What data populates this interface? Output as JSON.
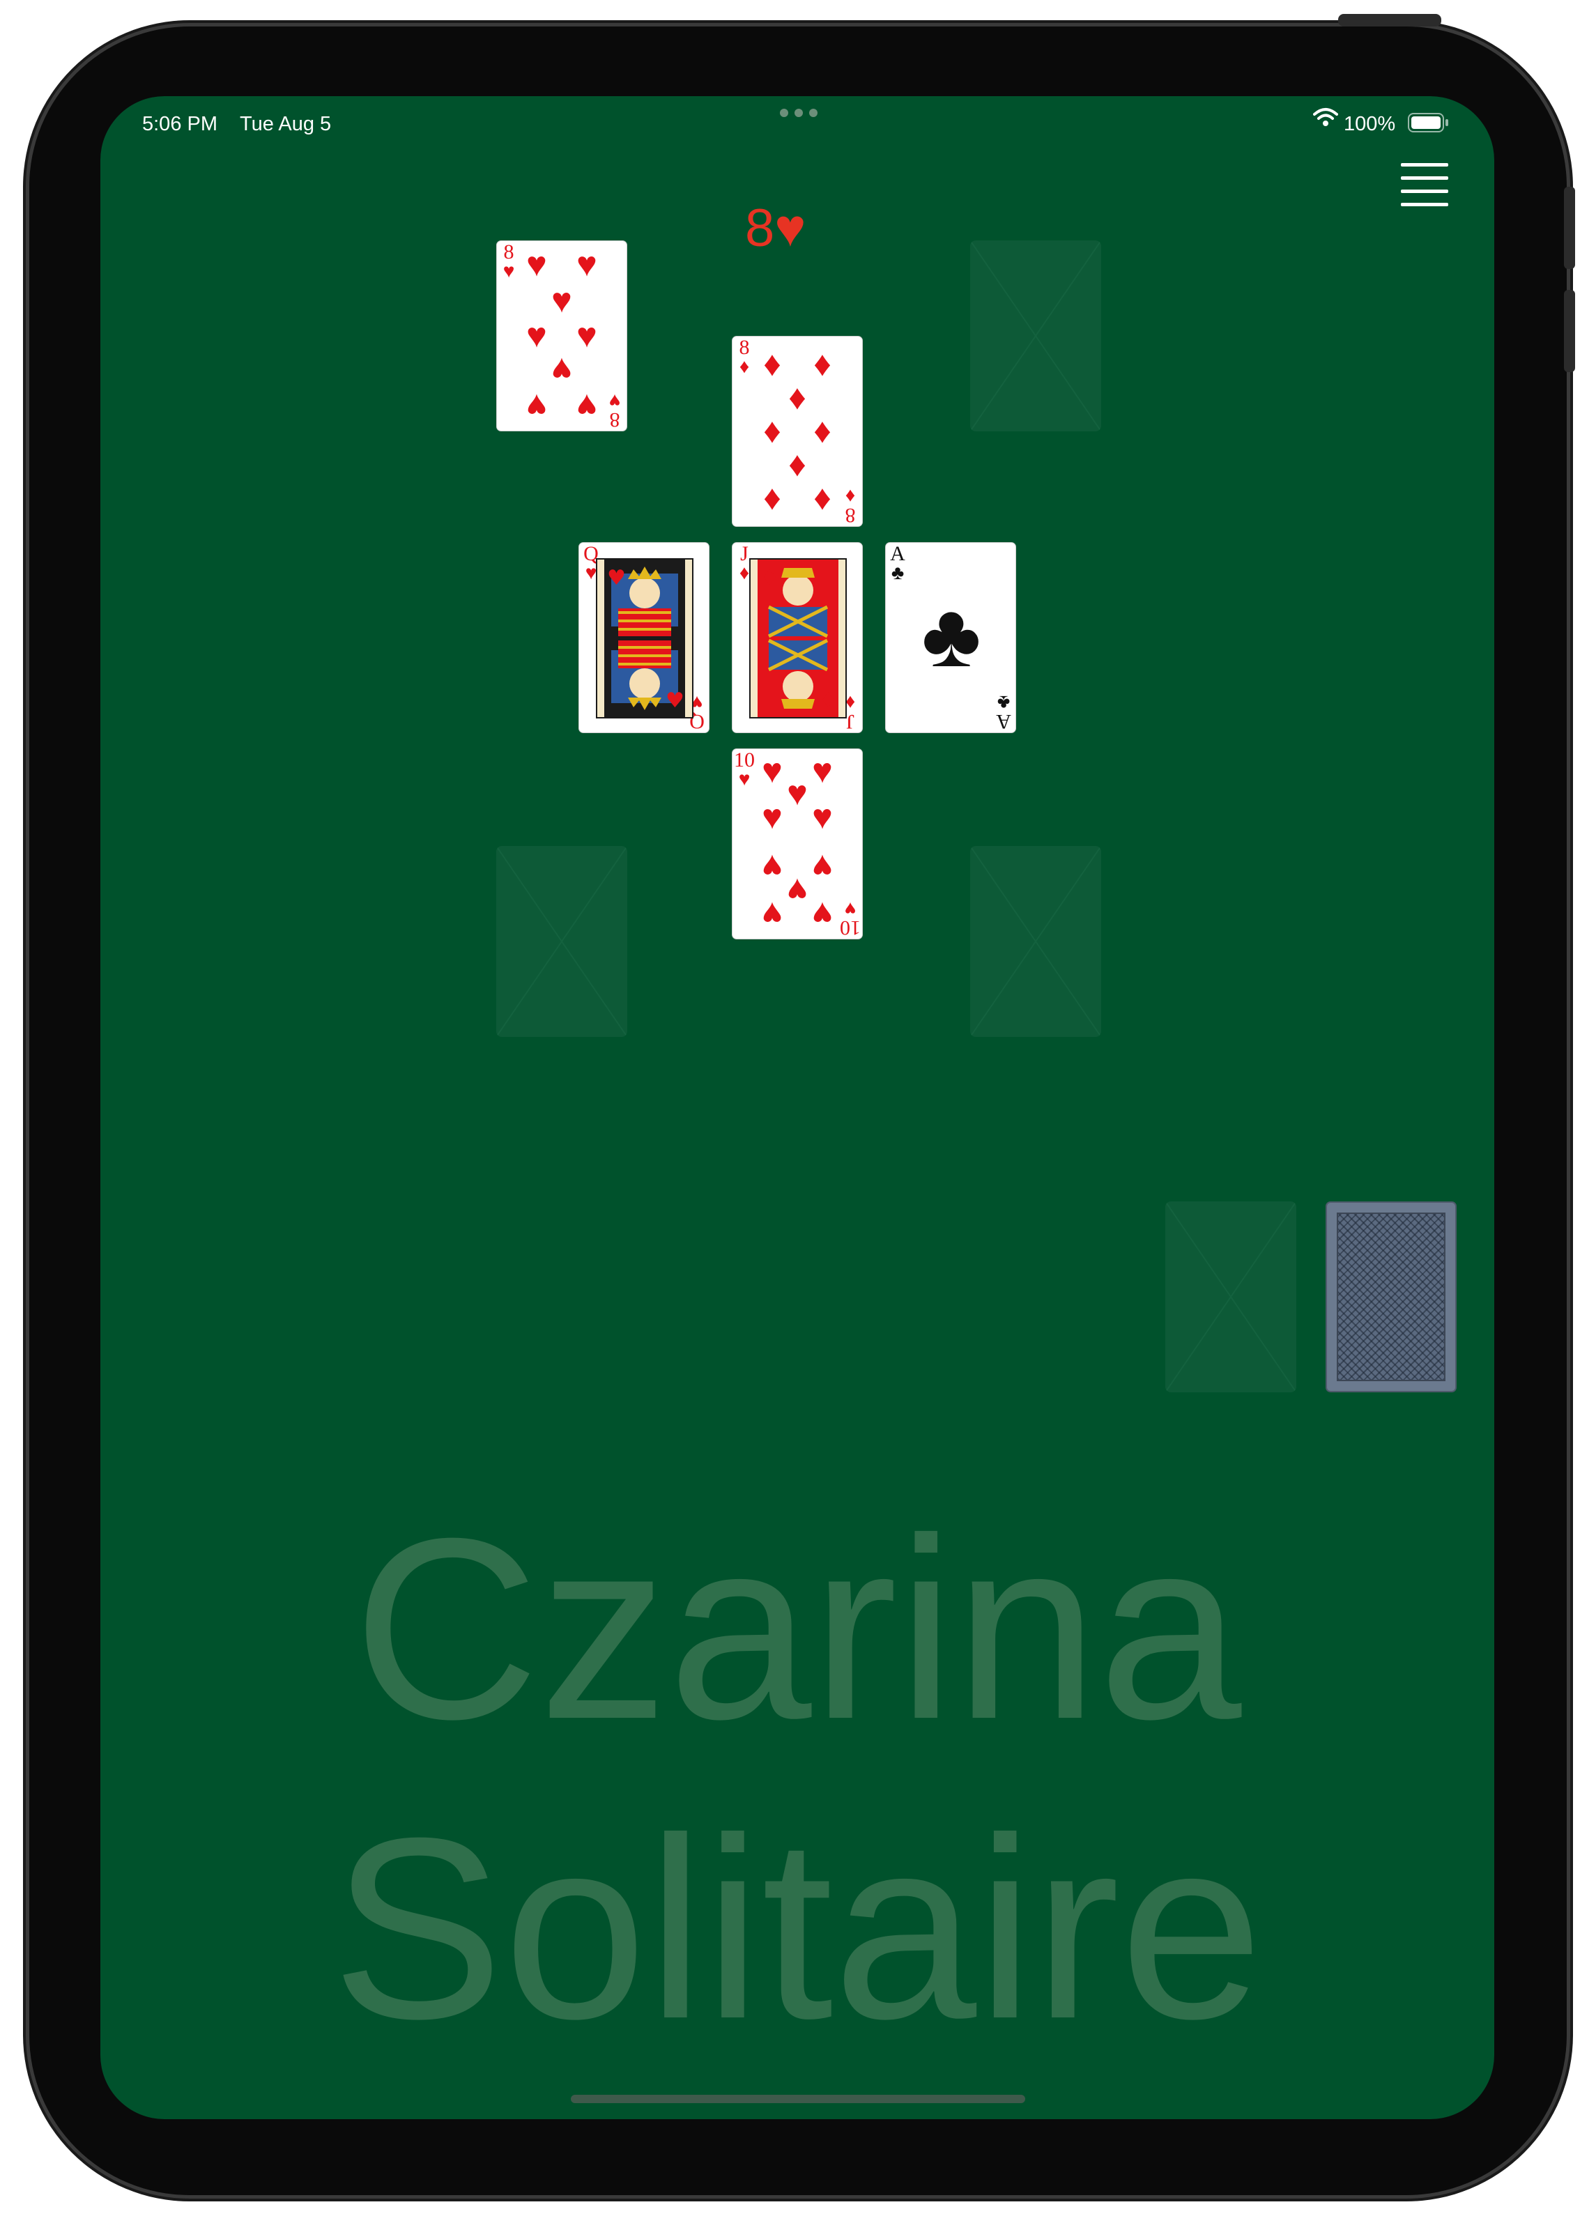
{
  "status_bar": {
    "time": "5:06 PM",
    "date": "Tue Aug 5",
    "battery": "100%"
  },
  "header": {
    "menu_icon": "hamburger-menu-icon",
    "current_rank": "8",
    "current_suit_symbol": "♥"
  },
  "cards": {
    "top_left": {
      "rank": "8",
      "suit": "♥",
      "color": "red"
    },
    "center_top": {
      "rank": "8",
      "suit": "♦",
      "color": "red"
    },
    "center_left": {
      "rank": "Q",
      "suit": "♥",
      "color": "red"
    },
    "center": {
      "rank": "J",
      "suit": "♦",
      "color": "red"
    },
    "center_right": {
      "rank": "A",
      "suit": "♣",
      "color": "black"
    },
    "center_bottom": {
      "rank": "10",
      "suit": "♥",
      "color": "red"
    }
  },
  "background_title": {
    "line1": "Czarina",
    "line2": "Solitaire"
  },
  "colors": {
    "felt": "#00522c",
    "empty_slot": "#0d5a37",
    "red_suit": "#e4141b",
    "header_red": "#e73323",
    "title_text": "#2f6f4b",
    "card_back": "#6b7a8f"
  }
}
